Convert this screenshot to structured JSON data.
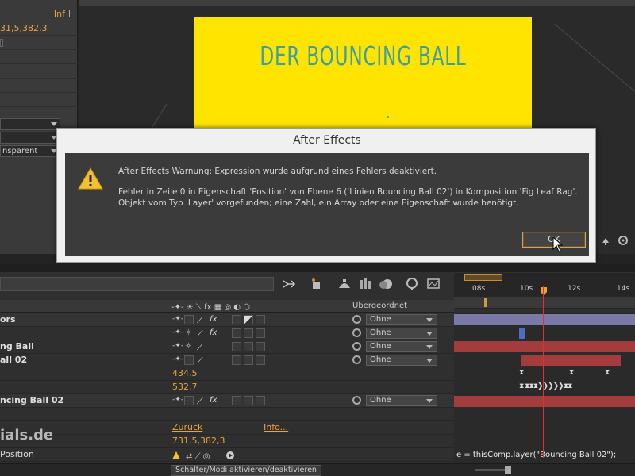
{
  "left_panel": {
    "top_label": "Inf",
    "position_value": "31,5,382,3",
    "dropdown_value": "nsparent"
  },
  "composition": {
    "title": "DER BOUNCING BALL",
    "background_color": "#ffe400",
    "title_color": "#3a9fa6"
  },
  "dialog": {
    "title": "After Effects",
    "line1": "After Effects Warnung: Expression wurde aufgrund eines Fehlers deaktiviert.",
    "line2": "Fehler in Zeile 0 in Eigenschaft 'Position' von Ebene 6 ('Linien Bouncing Ball 02') in Komposition 'Fig Leaf Rag'.",
    "line3": "Objekt vom Typ 'Layer' vorgefunden; eine Zahl, ein Array oder eine Eigenschaft wurde benötigt.",
    "ok_label": "OK",
    "icon": "warning-icon"
  },
  "timeline": {
    "ruler_ticks": [
      "08s",
      "10s",
      "12s",
      "14s"
    ],
    "parent_header": "Übergeordnet",
    "layers": [
      {
        "name": "ors",
        "parent": "Ohne",
        "has_fx": true
      },
      {
        "name": "",
        "parent": "Ohne",
        "has_fx": true
      },
      {
        "name": "ng Ball",
        "parent": "Ohne",
        "has_fx": false
      },
      {
        "name": "all 02",
        "parent": "Ohne",
        "has_fx": false
      },
      {
        "name": "ncing Ball 02",
        "parent": "Ohne",
        "has_fx": true
      }
    ],
    "prop_values": {
      "x": "434,5",
      "y": "532,7",
      "position": "731,5,382,3"
    },
    "zuruck": "Zurück",
    "info": "Info...",
    "expression_text": "e = thisComp.layer(\"Bouncing Ball 02\");",
    "position_label": "Position",
    "watermark": "ials.de",
    "toggle_label": "Schalter/Modi aktivieren/deaktivieren",
    "colors": {
      "accent": "#e8a33a",
      "red_bar": "#a33c3c",
      "purple_bar": "#7a7aa8",
      "cti": "#e03030"
    }
  }
}
